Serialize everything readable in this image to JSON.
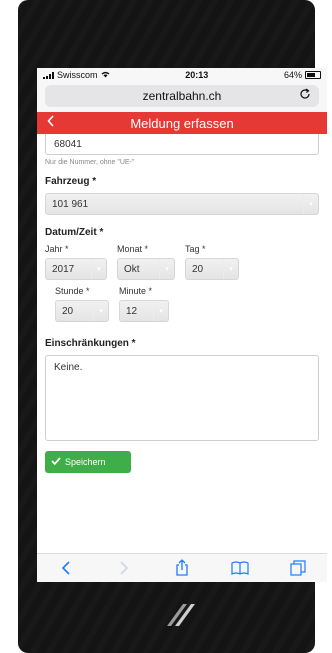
{
  "status_bar": {
    "carrier": "Swisscom",
    "time": "20:13",
    "battery": "64%"
  },
  "browser": {
    "url": "zentralbahn.ch"
  },
  "header": {
    "title": "Meldung erfassen"
  },
  "form": {
    "number_value": "68041",
    "number_hint": "Nur die Nummer, ohne \"UE-\"",
    "fahrzeug_label": "Fahrzeug *",
    "fahrzeug_value": "101 961",
    "datetime_label": "Datum/Zeit *",
    "jahr_label": "Jahr *",
    "jahr_value": "2017",
    "monat_label": "Monat *",
    "monat_value": "Okt",
    "tag_label": "Tag *",
    "tag_value": "20",
    "stunde_label": "Stunde *",
    "stunde_value": "20",
    "minute_label": "Minute *",
    "minute_value": "12",
    "einschraenkungen_label": "Einschränkungen *",
    "einschraenkungen_value": "Keine.",
    "save_label": "Speichern"
  },
  "colors": {
    "header_red": "#e53935",
    "save_green": "#3fae49",
    "link_blue": "#1e7cff"
  },
  "icons": {
    "wifi": "wifi-icon",
    "reload": "reload-icon",
    "back": "chevron-left-icon",
    "share": "share-icon",
    "bookmarks": "book-icon",
    "tabs": "tabs-icon"
  }
}
